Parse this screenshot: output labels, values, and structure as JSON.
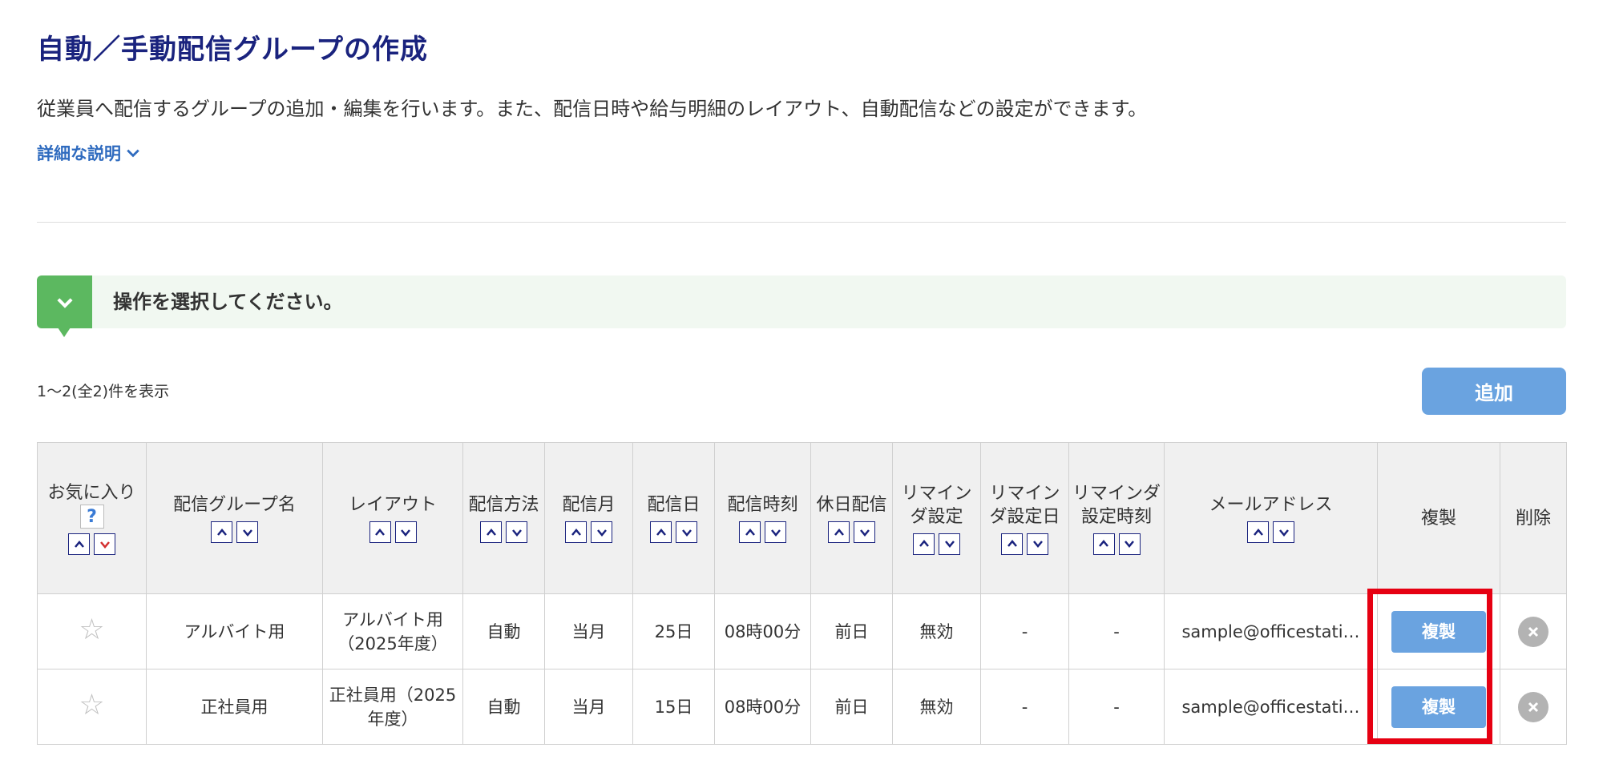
{
  "page": {
    "title": "自動／手動配信グループの作成",
    "description": "従業員へ配信するグループの追加・編集を行います。また、配信日時や給与明細のレイアウト、自動配信などの設定ができます。",
    "details_link": "詳細な説明"
  },
  "operation": {
    "prompt": "操作を選択してください。"
  },
  "list": {
    "count_text": "1〜2(全2)件を表示",
    "add_label": "追加"
  },
  "table": {
    "headers": {
      "favorite": "お気に入り",
      "help_mark": "?",
      "group_name": "配信グループ名",
      "layout": "レイアウト",
      "method": "配信方法",
      "month": "配信月",
      "day": "配信日",
      "time": "配信時刻",
      "holiday": "休日配信",
      "reminder": "リマインダ設定",
      "reminder_day": "リマインダ設定日",
      "reminder_time": "リマインダ設定時刻",
      "email": "メールアドレス",
      "copy": "複製",
      "delete": "削除"
    },
    "rows": [
      {
        "group_name": "アルバイト用",
        "layout": "アルバイト用（2025年度）",
        "method": "自動",
        "month": "当月",
        "day": "25日",
        "time": "08時00分",
        "holiday": "前日",
        "reminder": "無効",
        "reminder_day": "-",
        "reminder_time": "-",
        "email": "sample@officestati…",
        "copy_label": "複製"
      },
      {
        "group_name": "正社員用",
        "layout": "正社員用（2025年度）",
        "method": "自動",
        "month": "当月",
        "day": "15日",
        "time": "08時00分",
        "holiday": "前日",
        "reminder": "無効",
        "reminder_day": "-",
        "reminder_time": "-",
        "email": "sample@officestati…",
        "copy_label": "複製"
      }
    ]
  },
  "icons": {
    "favorite": "star-icon",
    "delete": "close-circle-icon",
    "sort_asc": "chevron-up-icon",
    "sort_desc": "chevron-down-icon"
  },
  "colors": {
    "title": "#1a237e",
    "link": "#2f6bbf",
    "accent_green": "#5cb860",
    "button_blue": "#6aa3e0",
    "highlight_red": "#e60012",
    "sort_desc_active": "#d32f2f"
  }
}
